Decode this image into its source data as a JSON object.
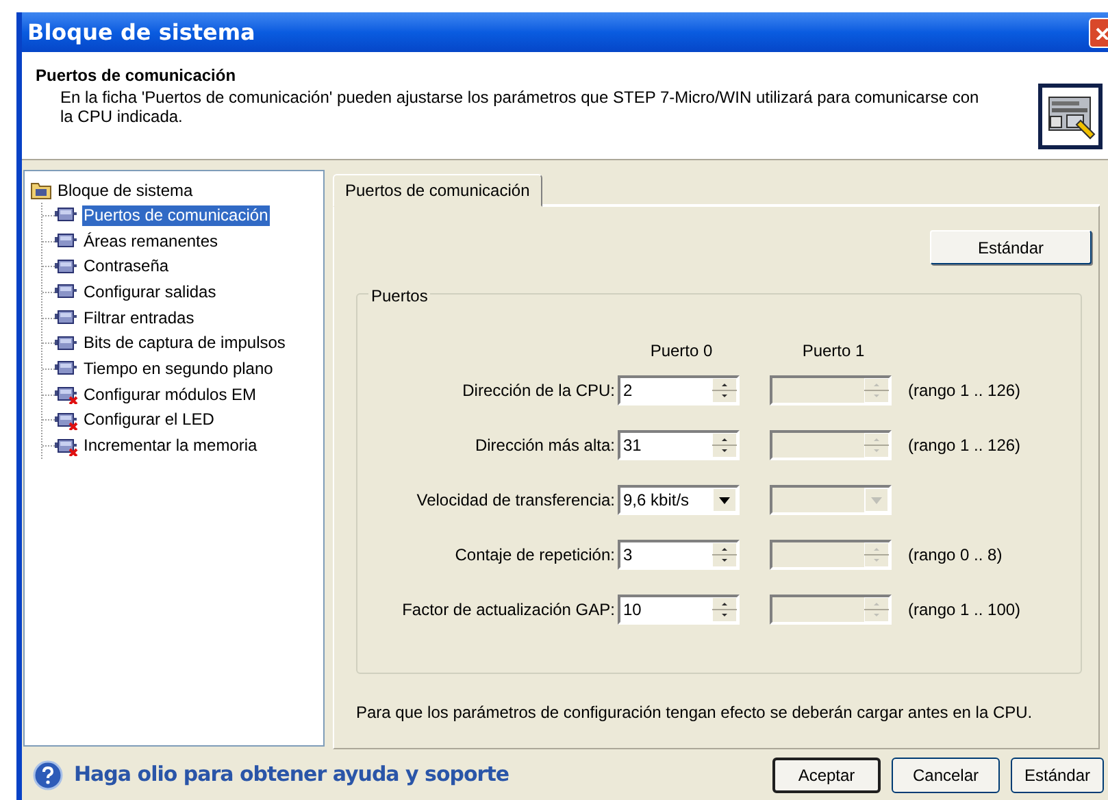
{
  "window": {
    "title": "Bloque de sistema"
  },
  "header": {
    "title": "Puertos de comunicación",
    "description": "En la ficha 'Puertos de comunicación' pueden ajustarse los parámetros que STEP 7-Micro/WIN utilizará para comunicarse con la CPU indicada."
  },
  "tree": {
    "root": "Bloque de sistema",
    "items": [
      {
        "label": "Puertos de comunicación",
        "selected": true,
        "error": false
      },
      {
        "label": "Áreas remanentes",
        "selected": false,
        "error": false
      },
      {
        "label": "Contraseña",
        "selected": false,
        "error": false
      },
      {
        "label": "Configurar salidas",
        "selected": false,
        "error": false
      },
      {
        "label": "Filtrar entradas",
        "selected": false,
        "error": false
      },
      {
        "label": "Bits de captura de impulsos",
        "selected": false,
        "error": false
      },
      {
        "label": "Tiempo en segundo plano",
        "selected": false,
        "error": false
      },
      {
        "label": "Configurar módulos EM",
        "selected": false,
        "error": true
      },
      {
        "label": "Configurar el LED",
        "selected": false,
        "error": true
      },
      {
        "label": "Incrementar la memoria",
        "selected": false,
        "error": true
      }
    ]
  },
  "tabs": [
    {
      "label": "Puertos de comunicación",
      "selected": true
    }
  ],
  "standard_button": "Estándar",
  "group": {
    "title": "Puertos",
    "columns": [
      "Puerto 0",
      "Puerto 1"
    ],
    "rows": [
      {
        "label": "Dirección de la CPU:",
        "kind": "spin",
        "value": "2",
        "port1_disabled": true,
        "range": "(rango 1 .. 126)"
      },
      {
        "label": "Dirección más alta:",
        "kind": "spin",
        "value": "31",
        "port1_disabled": true,
        "range": "(rango 1 .. 126)"
      },
      {
        "label": "Velocidad de transferencia:",
        "kind": "dropdown",
        "value": "9,6 kbit/s",
        "port1_disabled": true
      },
      {
        "label": "Contaje de repetición:",
        "kind": "spin",
        "value": "3",
        "port1_disabled": true,
        "range": "(rango 0 .. 8)"
      },
      {
        "label": "Factor de actualización GAP:",
        "kind": "spin",
        "value": "10",
        "port1_disabled": true,
        "range": "(rango 1 .. 100)"
      }
    ]
  },
  "note": "Para que los parámetros de configuración tengan efecto se deberán cargar antes en la CPU.",
  "help_link": "Haga olio para obtener ayuda y soporte",
  "buttons": [
    {
      "label": "Aceptar",
      "default": true
    },
    {
      "label": "Cancelar",
      "default": false
    },
    {
      "label": "Estándar",
      "default": false
    }
  ]
}
